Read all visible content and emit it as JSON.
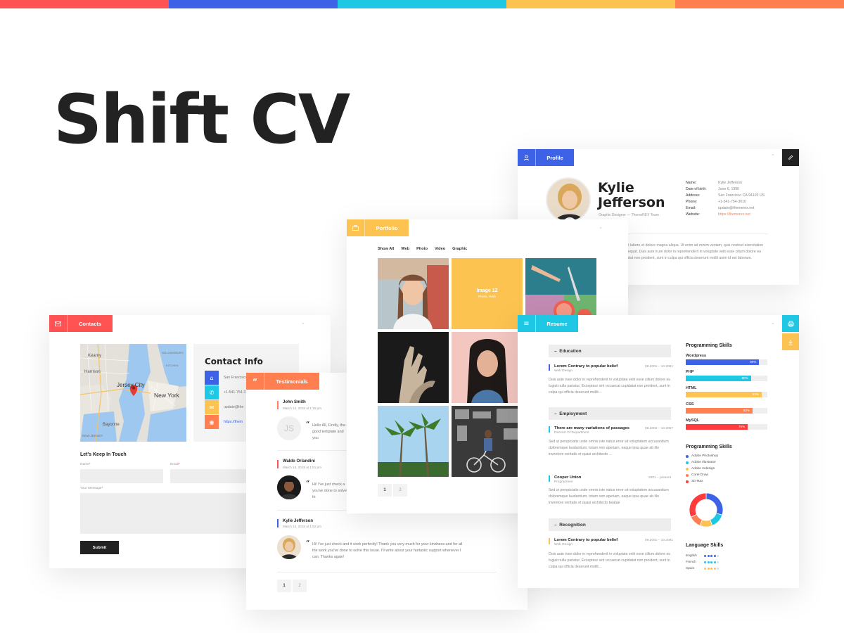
{
  "colors": {
    "red": "#ff5252",
    "blue": "#3d62e5",
    "cyan": "#1ec8e5",
    "yellow": "#fdc350",
    "orange": "#ff7f50"
  },
  "brand": {
    "title": "Shift CV"
  },
  "profile": {
    "tab_label": "Profile",
    "first_name": "Kylie",
    "last_name": "Jefferson",
    "role": "Graphic Designer — ThemeREX Team",
    "info": [
      {
        "label": "Name:",
        "value": "Kylie Jefferson"
      },
      {
        "label": "Date of birth:",
        "value": "June 6, 1990"
      },
      {
        "label": "Address:",
        "value": "San Francisco CA 94102 US"
      },
      {
        "label": "Phone:",
        "value": "+1-541-754-3010"
      },
      {
        "label": "Email:",
        "value": "update@themerex.net"
      },
      {
        "label": "Website:",
        "value": "https://themerex.net"
      }
    ],
    "bio": "adipisicing elit, sed do eiusmod tempor incididunt ut labore et dolore magna aliqua. Ut enim ad minim veniam, quis nostrud exercitation ullamco laboris nisi ut aliquip ex ea commodo consequat. Duis aute irure dolor in reprehenderit in voluptate velit esse cillum dolore eu fugiat nulla pariatur. Excepteur sint occaecat cupidatat non proident, sunt in culpa qui officia deserunt mollit anim id est laborum."
  },
  "portfolio": {
    "tab_label": "Portfolio",
    "filters": [
      "Show All",
      "Web",
      "Photo",
      "Video",
      "Graphic"
    ],
    "featured_title": "Image 12",
    "featured_sub": "Photo, Web",
    "pages": [
      "1",
      "2"
    ]
  },
  "resume": {
    "tab_label": "Resume",
    "sections": {
      "education": "Education",
      "employment": "Employment",
      "recognition": "Recognition"
    },
    "entries": [
      {
        "title": "Lorem Contrary to popular belief",
        "sub": "Web Design",
        "date": "09.2001 – 10.2001",
        "text": "Duis aute irure dolor in reprehenderit in voluptate velit esse cillum dolore eu fugiat nulla pariatur. Excepteur sint occaecat cupidatat non proident, sunt in culpa qui officia deserunt mollit..."
      },
      {
        "title": "There are many variations of passages",
        "sub": "Director Of Department",
        "date": "06.2003 – 10.2007",
        "text": "Sed ut perspiciatis unde omnis iste natus error sit voluptatem accusantium doloremque laudantium, totam rem aperiam, eaque ipsa quae ab illo inventore veritatis et quasi architecto ..."
      },
      {
        "title": "Cooper Union",
        "sub": "Programmer",
        "date": "2001 – present",
        "text": "Sed ut perspiciatis unde omnis iste natus error sit voluptatem accusantium doloremque laudantium, totam rem aperiam, eaque ipsa quae ab illo inventore veritatis et quasi architecto beatae"
      },
      {
        "title": "Lorem Contrary to popular belief",
        "sub": "Web Design",
        "date": "09.2001 – 10.2001",
        "text": "Duis aute irure dolor in reprehenderit in voluptate velit esse cillum dolore eu fugiat nulla pariatur. Excepteur sint occaecat cupidatat non proident, sunt in culpa qui officia deserunt mollit..."
      }
    ],
    "programming_skills_title": "Programming Skills",
    "bars": [
      {
        "name": "Wordpress",
        "percent": 90,
        "label": "90%",
        "color": "#3d62e5"
      },
      {
        "name": "PHP",
        "percent": 80,
        "label": "80%",
        "color": "#1ec8e5"
      },
      {
        "name": "HTML",
        "percent": 93,
        "label": "93%",
        "color": "#fdc350"
      },
      {
        "name": "CSS",
        "percent": 82,
        "label": "82%",
        "color": "#ff7f50"
      },
      {
        "name": "MySQL",
        "percent": 76,
        "label": "76%",
        "color": "#ff3b3b"
      }
    ],
    "programming_skills_title_2": "Programming Skills",
    "legend": [
      {
        "name": "Adobe Photoshop",
        "color": "#3d62e5"
      },
      {
        "name": "Adobe Illustrator",
        "color": "#1ec8e5"
      },
      {
        "name": "Adobe Indesign",
        "color": "#fdc350"
      },
      {
        "name": "Corel Draw",
        "color": "#ff7f50"
      },
      {
        "name": "3D Max",
        "color": "#ff3b3b"
      }
    ],
    "donut": [
      {
        "name": "Adobe Photoshop",
        "value": 30,
        "color": "#3d62e5"
      },
      {
        "name": "Adobe Illustrator",
        "value": 14,
        "color": "#1ec8e5"
      },
      {
        "name": "Adobe Indesign",
        "value": 12,
        "color": "#fdc350"
      },
      {
        "name": "Corel Draw",
        "value": 12,
        "color": "#ff7f50"
      },
      {
        "name": "3D Max",
        "value": 32,
        "color": "#ff3b3b"
      }
    ],
    "language_title": "Language Skills",
    "languages": [
      {
        "name": "English",
        "level": 4,
        "color": "#3d62e5"
      },
      {
        "name": "French",
        "level": 4,
        "color": "#1ec8e5"
      },
      {
        "name": "Spain",
        "level": 4,
        "color": "#fdc350"
      }
    ]
  },
  "contacts": {
    "tab_label": "Contacts",
    "map_labels": [
      "Kearny",
      "Harrison",
      "Jersey City",
      "New York",
      "Bayonne",
      "NEW JERSEY",
      "WILLIAMSBURG",
      "KITCHEN"
    ],
    "info_title": "Contact Info",
    "info": [
      {
        "icon": "home-icon",
        "text": "San Francisco"
      },
      {
        "icon": "phone-icon",
        "text": "+1-541-754-3"
      },
      {
        "icon": "mail-icon",
        "text": "update@the"
      },
      {
        "icon": "globe-icon",
        "text": "https://them"
      }
    ],
    "form_title": "Let's Keep In Touch",
    "name_label": "Name",
    "email_label": "Email",
    "message_label": "Your Message",
    "required_mark": "*",
    "submit_label": "Submit"
  },
  "testimonials": {
    "tab_label": "Testimonials",
    "items": [
      {
        "name": "John Smith",
        "date": "March 14, 2018 at 1:16 pm",
        "initials": "JS",
        "text": "Hello All, Firstly, tha good template and you"
      },
      {
        "name": "Waldo Orlandini",
        "date": "March 14, 2018 at 1:51 pm",
        "text": "Hi! I've just check a you've done to solve th"
      },
      {
        "name": "Kylie Jefferson",
        "date": "March 14, 2018 at 1:52 pm",
        "text": "Hi! I've just check and it work perfectly! Thank you very much for your kindness and for all the work you've done to solve this issue. I'll write about your fantastic support whenever I can. Thanks again!"
      }
    ],
    "pages": [
      "1",
      "2"
    ]
  }
}
